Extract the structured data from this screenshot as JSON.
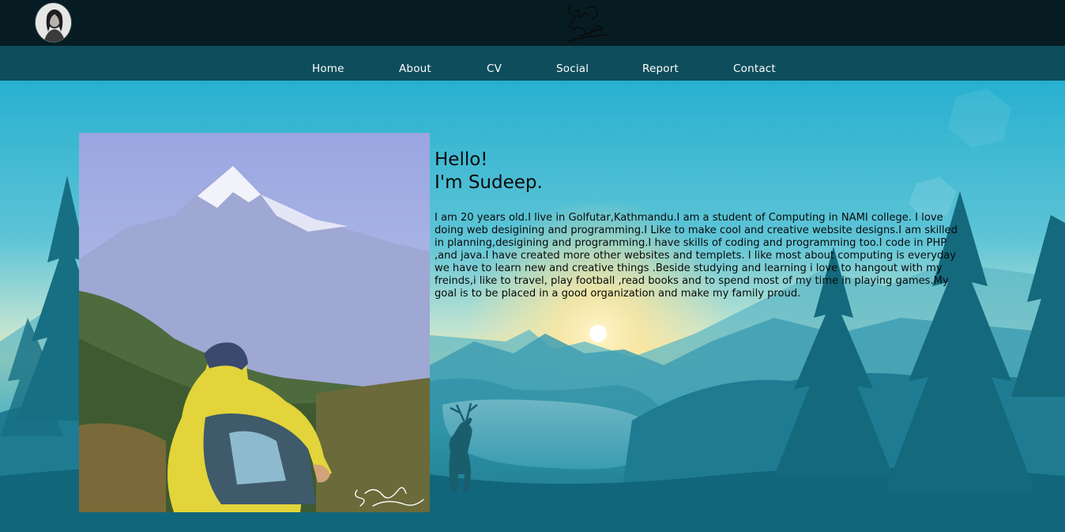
{
  "header": {
    "avatar_icon": "profile-avatar",
    "logo_icon": "signature-logo"
  },
  "nav": {
    "items": [
      {
        "label": "Home"
      },
      {
        "label": "About"
      },
      {
        "label": "CV"
      },
      {
        "label": "Social"
      },
      {
        "label": "Report"
      },
      {
        "label": "Contact"
      }
    ]
  },
  "main": {
    "greeting_line1": "Hello!",
    "greeting_line2": "I'm Sudeep.",
    "bio": "I am 20 years old.I live in Golfutar,Kathmandu.I am a student of Computing in NAMI college. I love doing web desigining and programming.I Like to make cool and creative website designs.I am skilled in planning,desigining and programming.I have skills of coding and programming too.I code in PHP ,and java.I have created more other websites and templets. I like most about computing is everyday we have to learn new and creative things .Beside studying and learning i love to hangout with my freinds,i like to travel, play football ,read books and to spend most of my time in playing games.My goal is to be placed in a good organization and make my family proud.",
    "photo_icon": "mountain-hiker-photo",
    "background_icon": "lake-landscape-illustration"
  },
  "colors": {
    "topbar": "#061c22",
    "navbar": "#0e4e5c",
    "sky_top": "#27b0d0",
    "nav_text": "#ffffff",
    "body_text": "#0a0a0a"
  }
}
